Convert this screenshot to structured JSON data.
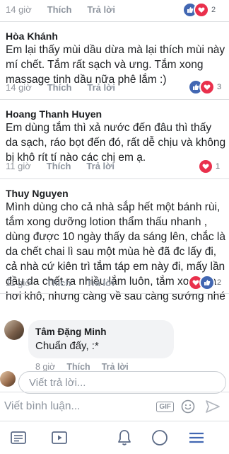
{
  "top_meta": {
    "time": "14 giờ",
    "like": "Thích",
    "reply": "Trả lời",
    "react_count": "2"
  },
  "comments": [
    {
      "name": "Hòa Khánh",
      "text": "Em lại thấy mùi dầu dừa mà lại thích mùi này mí chết. Tắm rất sạch và ưng. Tắm xong massage tinh dầu nữa phê lắm :)",
      "time": "14 giờ",
      "like": "Thích",
      "reply": "Trả lời",
      "react_count": "3"
    },
    {
      "name": "Hoang Thanh Huyen",
      "text": "Em dùng tắm thì xả nước  đến đâu thì thấy da sạch, ráo bọt đến đó, rất dễ chịu và không bị khô rít tí nào các chị em ạ.",
      "time": "11 giờ",
      "like": "Thích",
      "reply": "Trả lời",
      "react_count": "1"
    },
    {
      "name": "Thuy Nguyen",
      "text": "Mình dùng cho cả nhà sắp hết một bánh rùi, tắm xong dưỡng lotion thẩm thấu nhanh , dùng được 10 ngày thấy da sáng lên, chắc là da chết chai lì sau một mùa hè đã đc lấy đi, cả nhà cứ kiên trì tắm táp em này đi, mấy lần đầu da chết ra nhiều lắm luôn, tắm xong da hơi khô, nhưng càng về sau càng sướng nhé",
      "time": "11 giờ",
      "like": "Thích",
      "reply": "Trả lời",
      "react_count": "2"
    }
  ],
  "reply": {
    "name": "Tâm Đặng Minh",
    "text": "Chuẩn đấy, :*",
    "time": "8 giờ",
    "like": "Thích",
    "reply": "Trả lời"
  },
  "reply_input": {
    "placeholder": "Viết trả lời..."
  },
  "composer": {
    "placeholder": "Viết bình luận...",
    "gif_label": "GIF"
  },
  "colors": {
    "like": "#4267b2",
    "love": "#e9304c",
    "accent": "#4267b2"
  },
  "tabbar": {
    "items": [
      "home-icon",
      "video-icon",
      "bell-icon",
      "profile-icon",
      "menu-icon"
    ],
    "active": "menu-icon"
  }
}
